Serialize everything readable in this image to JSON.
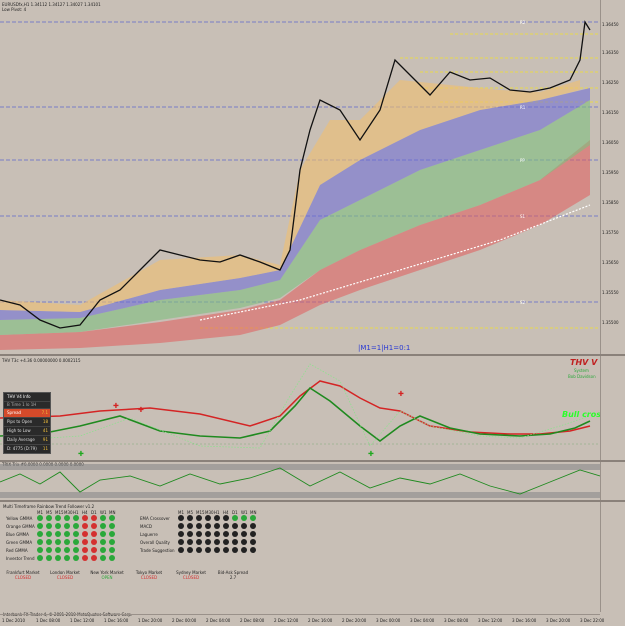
{
  "header": {
    "symbol_line": "EURUSDfx,H1 1.34112 1.34127 1.34027 1.34101",
    "sub_line": "Low Pivot: 4"
  },
  "main_chart": {
    "annotation": "|M1=1|H1=0:1",
    "price_levels": [
      "1.36450",
      "1.36400",
      "1.36350",
      "1.36300",
      "1.36250",
      "1.36200",
      "1.36150",
      "1.36100",
      "1.36050",
      "1.36000",
      "1.35950",
      "1.35900",
      "1.35850",
      "1.35800",
      "1.35750",
      "1.35700",
      "1.35650",
      "1.35600",
      "1.35550",
      "1.35500"
    ],
    "level_tags": [
      "R2",
      "R1",
      "PP",
      "S1",
      "S2"
    ],
    "colors": {
      "green_line": "#1fa81f",
      "red_line": "#d42424",
      "yellow": "#f2e22a",
      "blue_dash": "#2a3ad4"
    }
  },
  "indicator1": {
    "header": "THV T3c +4.36 0.00000000 0.0002115",
    "title": "THV V 3",
    "system": "System",
    "subtitle": "Bob Davidson",
    "cross_label": "Bull cross",
    "info_box": {
      "title": "THV   V4   Info",
      "sub": "B Time 1 lo 1H",
      "rows": [
        {
          "label": "Spread",
          "value": "7.1"
        },
        {
          "label": "Pips to Open",
          "value": "18"
        },
        {
          "label": "High to Low",
          "value": "41"
        },
        {
          "label": "Daily Average",
          "value": "91"
        },
        {
          "label": "D: 4775 (D:79)",
          "value": "11"
        }
      ]
    }
  },
  "indicator2": {
    "header": "TRIX Trix #0.0000 0.0000 0.0000 0.0000"
  },
  "dashboard": {
    "title": "Multi Timeframe Rainbow Trend Follower v1.2",
    "timeframes": [
      "M1",
      "M5",
      "M15",
      "M30",
      "H1",
      "H4",
      "D1",
      "W1",
      "MN"
    ],
    "left_rows": [
      "Yellow GMMA",
      "Orange GMMA",
      "Blue GMMA",
      "Green GMMA",
      "Red GMMA",
      "Investor Trend"
    ],
    "right_rows": [
      "EMA Crossover",
      "MACD",
      "Laguerre",
      "Overall Quality",
      "Trade Suggestion"
    ],
    "markets": [
      {
        "name": "Frankfurt Market",
        "status": "CLOSED"
      },
      {
        "name": "London Market",
        "status": "CLOSED"
      },
      {
        "name": "New York Market",
        "status": "OPEN"
      },
      {
        "name": "Tokyo Market",
        "status": "CLOSED"
      },
      {
        "name": "Sydney Market",
        "status": "CLOSED"
      },
      {
        "name": "Bid-Ask Spread",
        "status": "2.7"
      }
    ],
    "copyright": "Interbank FX Trader 4, © 2001-2010 MetaQuotes Software Corp."
  },
  "time_axis": [
    "1 Dec 2010",
    "1 Dec 08:00",
    "1 Dec 12:00",
    "1 Dec 16:00",
    "1 Dec 20:00",
    "2 Dec 00:00",
    "2 Dec 04:00",
    "2 Dec 08:00",
    "2 Dec 12:00",
    "2 Dec 16:00",
    "2 Dec 20:00",
    "3 Dec 00:00",
    "3 Dec 04:00",
    "3 Dec 08:00",
    "3 Dec 12:00",
    "3 Dec 16:00",
    "3 Dec 20:00",
    "3 Dec 22:00"
  ]
}
